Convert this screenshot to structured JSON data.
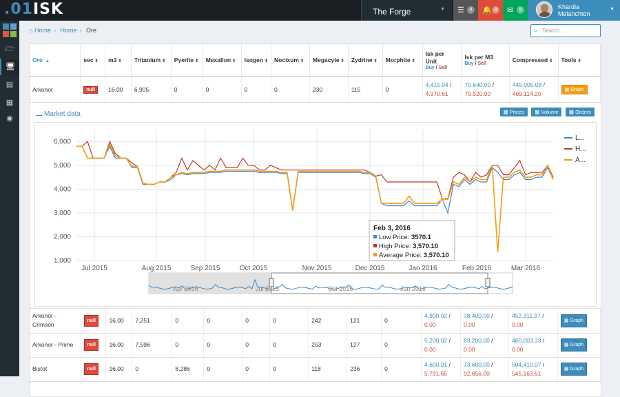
{
  "header": {
    "logo_prefix": ".01",
    "logo_suffix": "ISK",
    "region": "The Forge",
    "notifications": [
      {
        "icon": "tasks-icon",
        "count": "4",
        "color": "#555555"
      },
      {
        "icon": "bell-icon",
        "count": "8",
        "color": "#dd4b39"
      },
      {
        "icon": "envelope-icon",
        "count": "5",
        "color": "#00a65a"
      }
    ],
    "user_first": "Khardia",
    "user_last": "Melanchton"
  },
  "sidebar": {
    "items": [
      "logo-grid",
      "folder-icon",
      "monitor-icon",
      "list-icon",
      "calendar-icon",
      "circle-icon"
    ],
    "active": 2
  },
  "breadcrumb": {
    "home1": "Home",
    "home2": "Home",
    "current": "Ore"
  },
  "search": {
    "placeholder": "Search ..."
  },
  "table": {
    "columns": [
      {
        "label": "Ore",
        "sort": "▲"
      },
      {
        "label": "sec",
        "sort": "⬍"
      },
      {
        "label": "m3",
        "sort": "⬍"
      },
      {
        "label": "Tritanium",
        "sort": "⬍"
      },
      {
        "label": "Pyerite",
        "sort": "⬍"
      },
      {
        "label": "Mexallon",
        "sort": "⬍"
      },
      {
        "label": "Isogen",
        "sort": "⬍"
      },
      {
        "label": "Nocixum",
        "sort": "⬍"
      },
      {
        "label": "Megacyte",
        "sort": "⬍"
      },
      {
        "label": "Zydrine",
        "sort": "⬍"
      },
      {
        "label": "Morphite",
        "sort": "⬍"
      },
      {
        "label": "Isk per Unit",
        "sort": ""
      },
      {
        "label": "Isk per M3",
        "sort": ""
      },
      {
        "label": "Compressed",
        "sort": "⬍"
      },
      {
        "label": "Tools",
        "sort": "⬍"
      }
    ],
    "buy_label": "Buy",
    "sell_label": "Sell",
    "slash": " / ",
    "rows": [
      {
        "ore": "Arkonor",
        "sec": "null",
        "m3": "16.00",
        "tri": "6,905",
        "pye": "0",
        "mex": "0",
        "iso": "0",
        "noc": "0",
        "meg": "230",
        "zyd": "115",
        "mor": "0",
        "ipu_buy": "4,415.04",
        "ipu_sell": "4,970.61",
        "ipm_buy": "70,640.00",
        "ipm_sell": "79,520.00",
        "cmp_buy": "445,005.08",
        "cmp_sell": "469,114.20",
        "tool": "Graph"
      },
      {
        "ore": "Arkonor - Crimson",
        "sec": "null",
        "m3": "16.00",
        "tri": "7,251",
        "pye": "0",
        "mex": "0",
        "iso": "0",
        "noc": "0",
        "meg": "242",
        "zyd": "121",
        "mor": "0",
        "ipu_buy": "4,900.02",
        "ipu_sell": "0.00",
        "ipm_buy": "78,400.00",
        "ipm_sell": "0.00",
        "cmp_buy": "452,311.97",
        "cmp_sell": "0.00",
        "tool": "Graph"
      },
      {
        "ore": "Arkonor - Prime",
        "sec": "null",
        "m3": "16.00",
        "tri": "7,596",
        "pye": "0",
        "mex": "0",
        "iso": "0",
        "noc": "0",
        "meg": "253",
        "zyd": "127",
        "mor": "0",
        "ipu_buy": "5,200.02",
        "ipu_sell": "0.00",
        "ipm_buy": "83,200.00",
        "ipm_sell": "0.00",
        "cmp_buy": "460,003.33",
        "cmp_sell": "0.00",
        "tool": "Graph"
      },
      {
        "ore": "Bistot",
        "sec": "null",
        "m3": "16.00",
        "tri": "0",
        "pye": "8,286",
        "mex": "0",
        "iso": "0",
        "noc": "0",
        "meg": "118",
        "zyd": "236",
        "mor": "0",
        "ipu_buy": "4,600.01",
        "ipu_sell": "5,791.65",
        "ipm_buy": "73,600.00",
        "ipm_sell": "92,656.00",
        "cmp_buy": "504,410.07",
        "cmp_sell": "545,163.61",
        "tool": "Graph"
      }
    ]
  },
  "market": {
    "title": "Market data",
    "buttons": [
      "Prices",
      "Volume",
      "Orders"
    ],
    "tooltip": {
      "date": "Feb 3, 2016",
      "low_label": "Low Price:",
      "low": "3570.1",
      "high_label": "High Price:",
      "high": "3,570.10",
      "avg_label": "Average Price:",
      "avg": "3,570.10"
    },
    "navigator_labels": [
      "Apr 2015",
      "Jul 2015",
      "Oct 2015",
      "Jan 2016"
    ]
  },
  "chart_data": {
    "type": "line",
    "y_ticks": [
      "6,000",
      "5,000",
      "4,000",
      "3,000",
      "2,000",
      "1,000"
    ],
    "x_ticks": [
      "Jul 2015",
      "Aug 2015",
      "Sep 2015",
      "Oct 2015",
      "Nov 2015",
      "Dec 2015",
      "Jan 2016",
      "Feb 2016",
      "Mar 2016"
    ],
    "ylim": [
      1000,
      6500
    ],
    "legend": [
      "L...",
      "H...",
      "A..."
    ],
    "legend_placement": "top-right",
    "colors": {
      "low": "#3a87c8",
      "high": "#c0392b",
      "avg": "#f39c12"
    },
    "avg": [
      5800,
      5800,
      5300,
      5300,
      5300,
      5300,
      5900,
      5400,
      5300,
      5300,
      4950,
      4950,
      4250,
      4200,
      4200,
      4300,
      4300,
      4500,
      4600,
      4700,
      4650,
      4700,
      4700,
      4700,
      4750,
      4750,
      4750,
      4800,
      4800,
      4800,
      4800,
      4800,
      4800,
      4750,
      4750,
      4750,
      4750,
      4700,
      4700,
      3100,
      4750,
      4750,
      4750,
      4750,
      4750,
      4750,
      4750,
      4750,
      4750,
      4750,
      4750,
      4750,
      4700,
      4700,
      4550,
      3400,
      3400,
      3400,
      3400,
      3400,
      3700,
      3400,
      3400,
      3400,
      3400,
      3400,
      3570,
      3570,
      4300,
      4200,
      4500,
      4300,
      4500,
      4400,
      4400,
      5000,
      1350,
      4500,
      4500,
      4700,
      4800,
      4500,
      4500,
      4600,
      4600,
      5000,
      4400
    ],
    "high": [
      5800,
      5800,
      6000,
      5300,
      5300,
      5300,
      6000,
      5500,
      5300,
      5300,
      5100,
      4950,
      4250,
      4200,
      4200,
      4300,
      4300,
      4500,
      4700,
      5300,
      4800,
      5200,
      5000,
      4800,
      5000,
      4800,
      5300,
      4900,
      4900,
      4900,
      5300,
      5000,
      5000,
      4800,
      4800,
      5000,
      4900,
      4800,
      4800,
      4800,
      4800,
      4800,
      4800,
      4800,
      4800,
      4800,
      4800,
      4800,
      4800,
      4800,
      4800,
      4800,
      4800,
      4700,
      4550,
      4600,
      4300,
      4300,
      4300,
      4300,
      4300,
      4300,
      4300,
      4300,
      4300,
      4300,
      3600,
      3600,
      4500,
      4700,
      4600,
      4300,
      4700,
      4500,
      4600,
      5000,
      5000,
      4600,
      4600,
      4900,
      5200,
      4600,
      4700,
      4700,
      4700,
      5000,
      4500
    ],
    "low": [
      5800,
      5800,
      5300,
      5300,
      5300,
      5300,
      5800,
      5300,
      5300,
      5300,
      4900,
      4900,
      4200,
      4200,
      4200,
      4300,
      4300,
      4400,
      4600,
      4650,
      4600,
      4650,
      4650,
      4650,
      4700,
      4700,
      4700,
      4750,
      4750,
      4750,
      4750,
      4750,
      4750,
      4700,
      4700,
      4700,
      4700,
      4650,
      4650,
      3100,
      4700,
      4700,
      4700,
      4700,
      4700,
      4700,
      4700,
      4700,
      4700,
      4700,
      4700,
      4700,
      4650,
      4650,
      4500,
      3400,
      3300,
      3300,
      3300,
      3300,
      3500,
      3300,
      3300,
      3300,
      3300,
      3300,
      3570,
      3000,
      4200,
      4100,
      4400,
      4200,
      4400,
      4300,
      4300,
      4900,
      4700,
      4400,
      4400,
      4600,
      4700,
      4400,
      4400,
      4500,
      4500,
      4900,
      4400
    ]
  }
}
